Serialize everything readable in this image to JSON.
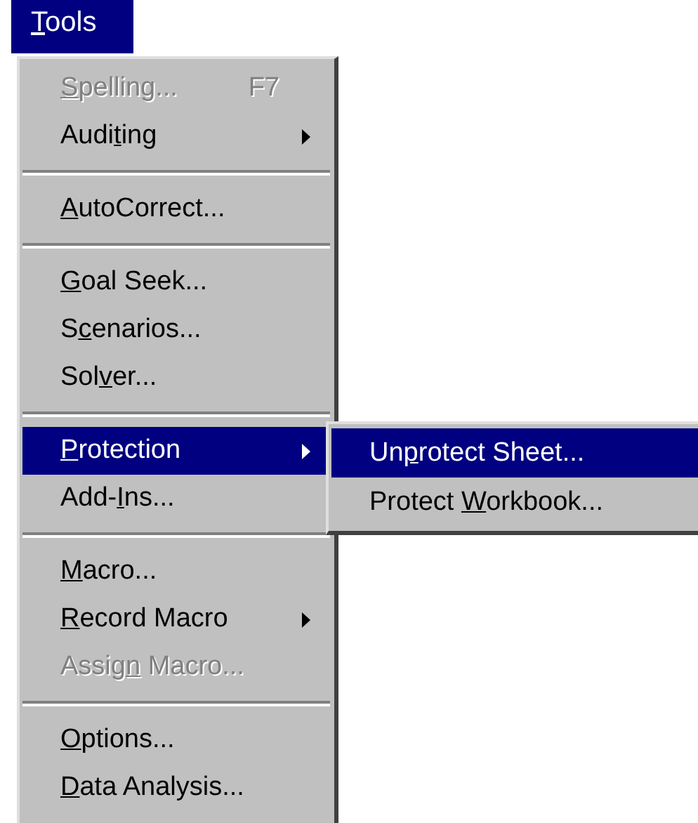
{
  "menu_title": {
    "key": "T",
    "after": "ools",
    "selected": true
  },
  "items": [
    {
      "kind": "item",
      "key": "S",
      "after": "pelling...",
      "shortcut": "F7",
      "disabled": true,
      "selected": false,
      "has_submenu": false
    },
    {
      "kind": "item",
      "before": "Audi",
      "key": "t",
      "after": "ing",
      "disabled": false,
      "selected": false,
      "has_submenu": true
    },
    {
      "kind": "separator"
    },
    {
      "kind": "item",
      "key": "A",
      "after": "utoCorrect...",
      "disabled": false,
      "selected": false,
      "has_submenu": false
    },
    {
      "kind": "separator"
    },
    {
      "kind": "item",
      "key": "G",
      "after": "oal Seek...",
      "disabled": false,
      "selected": false,
      "has_submenu": false
    },
    {
      "kind": "item",
      "before": "S",
      "key": "c",
      "after": "enarios...",
      "disabled": false,
      "selected": false,
      "has_submenu": false
    },
    {
      "kind": "item",
      "before": "Sol",
      "key": "v",
      "after": "er...",
      "disabled": false,
      "selected": false,
      "has_submenu": false
    },
    {
      "kind": "separator"
    },
    {
      "kind": "item",
      "key": "P",
      "after": "rotection",
      "disabled": false,
      "selected": true,
      "has_submenu": true,
      "submenu": [
        {
          "before": "Un",
          "key": "p",
          "after": "rotect Sheet...",
          "selected": true
        },
        {
          "before": "Protect ",
          "key": "W",
          "after": "orkbook...",
          "selected": false
        }
      ]
    },
    {
      "kind": "item",
      "before": "Add-",
      "key": "I",
      "after": "ns...",
      "disabled": false,
      "selected": false,
      "has_submenu": false
    },
    {
      "kind": "separator"
    },
    {
      "kind": "item",
      "key": "M",
      "after": "acro...",
      "disabled": false,
      "selected": false,
      "has_submenu": false
    },
    {
      "kind": "item",
      "key": "R",
      "after": "ecord Macro",
      "disabled": false,
      "selected": false,
      "has_submenu": true
    },
    {
      "kind": "item",
      "before": "Assig",
      "key": "n",
      "after": " Macro...",
      "disabled": true,
      "selected": false,
      "has_submenu": false
    },
    {
      "kind": "separator"
    },
    {
      "kind": "item",
      "key": "O",
      "after": "ptions...",
      "disabled": false,
      "selected": false,
      "has_submenu": false
    },
    {
      "kind": "item",
      "key": "D",
      "after": "ata Analysis...",
      "disabled": false,
      "selected": false,
      "has_submenu": false
    }
  ]
}
